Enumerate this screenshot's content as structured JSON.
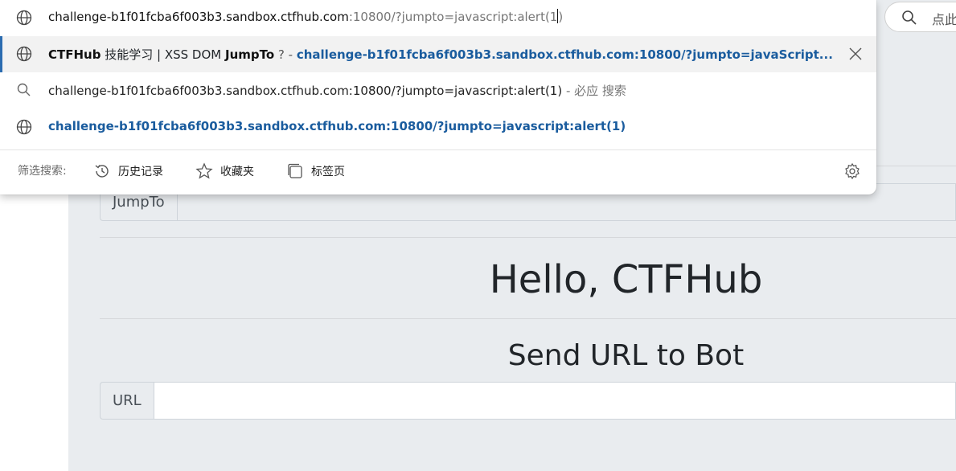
{
  "omnibox": {
    "input_domain": "challenge-b1f01fcba6f003b3.sandbox.ctfhub.com",
    "input_rest": ":10800/?jumpto=javascript:alert(1",
    "input_tail": ")",
    "suggestion_title_brand": "CTFHub",
    "suggestion_title_middle": " 技能学习 | XSS DOM ",
    "suggestion_title_bold": "JumpTo",
    "suggestion_title_end": " ? - ",
    "suggestion_url": "challenge-b1f01fcba6f003b3.sandbox.ctfhub.com:10800/?jumpto=javaScript...",
    "search_query": "challenge-b1f01fcba6f003b3.sandbox.ctfhub.com:10800/?jumpto=javascript:alert(1)",
    "search_suffix": " - 必应 搜索",
    "url_suggestion": "challenge-b1f01fcba6f003b3.sandbox.ctfhub.com:10800/?jumpto=javascript:alert(1)",
    "filter_label": "筛选搜索:",
    "filters": [
      "历史记录",
      "收藏夹",
      "标签页"
    ]
  },
  "toolbar": {
    "search_placeholder": "点此"
  },
  "page": {
    "jumpto_label": "JumpTo",
    "heading_main": "Hello, CTFHub",
    "heading_sub": "Send URL to Bot",
    "url_label": "URL"
  },
  "colors": {
    "accent": "#2b6cb0",
    "link": "#1a5c9e",
    "page_bg": "#e9ecef"
  }
}
